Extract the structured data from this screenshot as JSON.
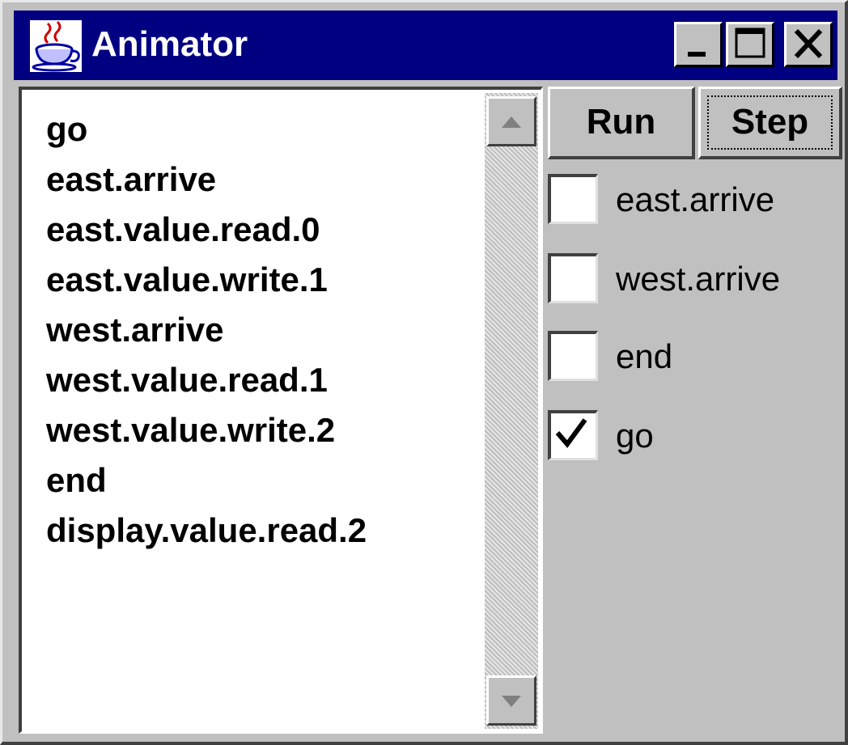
{
  "window": {
    "title": "Animator",
    "icon": "java-coffee-cup-icon",
    "controls": [
      "minimize-icon",
      "maximize-icon",
      "close-icon"
    ]
  },
  "trace": {
    "items": [
      "go",
      "east.arrive",
      "east.value.read.0",
      "east.value.write.1",
      "west.arrive",
      "west.value.read.1",
      "west.value.write.2",
      "end",
      "display.value.read.2"
    ]
  },
  "actions": {
    "run_label": "Run",
    "step_label": "Step"
  },
  "checkboxes": [
    {
      "label": "east.arrive",
      "checked": false
    },
    {
      "label": "west.arrive",
      "checked": false
    },
    {
      "label": "end",
      "checked": false
    },
    {
      "label": "go",
      "checked": true
    }
  ]
}
